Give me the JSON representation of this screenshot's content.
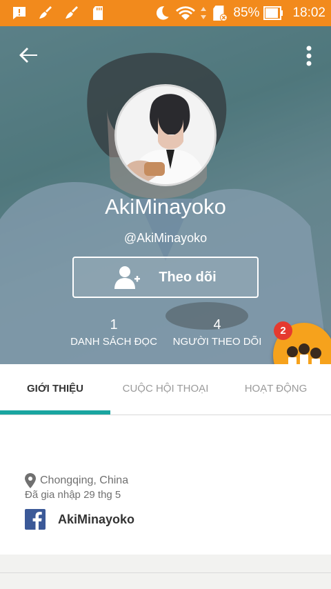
{
  "status_bar": {
    "battery_percent": "85%",
    "time": "18:02"
  },
  "profile": {
    "display_name": "AkiMinayoko",
    "username": "@AkiMinayoko",
    "follow_label": "Theo dõi"
  },
  "stats": {
    "reading_count": "1",
    "reading_label": "DANH SÁCH ĐỌC",
    "followers_count": "4",
    "followers_label": "NGƯỜI THEO DÕI"
  },
  "notification_badge": "2",
  "tabs": [
    {
      "label": "GIỚI THIỆU"
    },
    {
      "label": "CUỘC HỘI THOẠI"
    },
    {
      "label": "HOẠT ĐỘNG"
    }
  ],
  "about": {
    "location": "Chongqing, China",
    "joined": "Đã gia nhập 29 thg 5",
    "facebook_name": "AkiMinayoko"
  },
  "colors": {
    "status_bar": "#f28a1c",
    "tab_indicator": "#1aa5a0",
    "badge": "#e53a2f",
    "facebook": "#3b5998"
  }
}
